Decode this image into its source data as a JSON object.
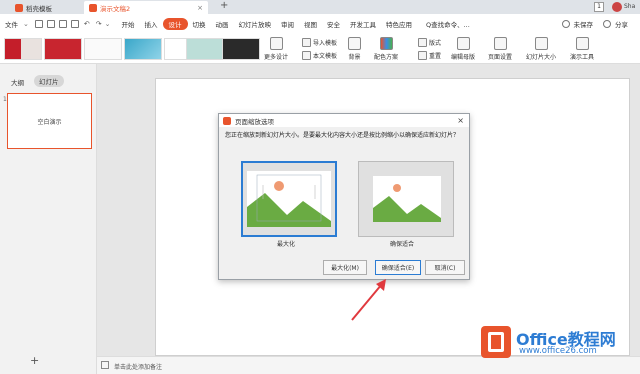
{
  "titlebar": {
    "tabs": [
      {
        "label": "稻壳模板"
      },
      {
        "label": "演示文稿2",
        "close": "×"
      }
    ],
    "new_tab": "+",
    "badge": "1",
    "user_short": "Sha"
  },
  "menubar": {
    "file": "文件",
    "items": [
      "开始",
      "插入",
      "设计",
      "切换",
      "动画",
      "幻灯片放映",
      "审阅",
      "视图",
      "安全",
      "开发工具",
      "特色应用"
    ],
    "active": "设计",
    "search": "Q查找命令、...",
    "unsaved": "未保存",
    "share": "分享"
  },
  "ribbon": {
    "more_design": "更多设计",
    "import_template": "导入模板",
    "text_template": "本文模板",
    "background": "背景",
    "color_scheme": "配色方案",
    "layout": "版式",
    "reset": "重置",
    "edit_master": "编辑母版",
    "page_setup": "页面设置",
    "slide_size": "幻灯片大小",
    "presentation_tools": "演示工具"
  },
  "leftpane": {
    "tab_outline": "大纲",
    "tab_slides": "幻灯片",
    "slide_text": "空白演示",
    "slide_number": "1",
    "add": "+"
  },
  "notes": {
    "placeholder": "单击此处添加备注"
  },
  "dialog": {
    "title": "页面缩放选项",
    "close": "×",
    "message": "您正在缩放到新幻灯片大小。是要最大化内容大小还是按比例缩小以确保适应新幻灯片？",
    "option_maximize": "最大化",
    "option_fit": "确保适合",
    "btn_maximize": "最大化(M)",
    "btn_fit": "确保适合(E)",
    "btn_cancel": "取消(C)"
  },
  "watermark": {
    "brand": "Office教程网",
    "url": "www.office26.com"
  },
  "colors": {
    "accent": "#e8542c",
    "selection": "#2b7cd3",
    "arrow": "#e0393e"
  }
}
